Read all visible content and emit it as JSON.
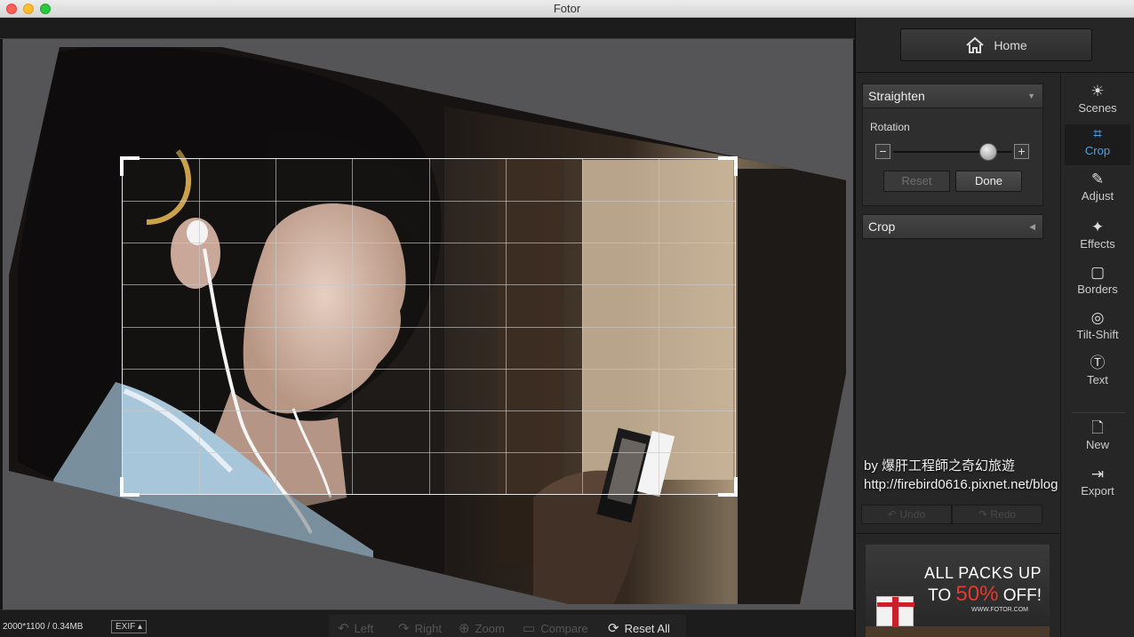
{
  "window": {
    "title": "Fotor"
  },
  "home": {
    "label": "Home",
    "icon": "house-icon"
  },
  "straighten": {
    "title": "Straighten",
    "rotation_label": "Rotation",
    "minus": "−",
    "plus": "+",
    "slider_value": 0.8,
    "reset_label": "Reset",
    "done_label": "Done"
  },
  "crop_section": {
    "title": "Crop"
  },
  "watermark": {
    "line1": "by 爆肝工程師之奇幻旅遊",
    "line2": "http://firebird0616.pixnet.net/blog"
  },
  "history": {
    "undo_label": "Undo",
    "redo_label": "Redo"
  },
  "sidebar": {
    "items": [
      {
        "label": "Scenes",
        "icon": "sun-icon"
      },
      {
        "label": "Crop",
        "icon": "crop-icon",
        "active": true
      },
      {
        "label": "Adjust",
        "icon": "pencil-icon"
      },
      {
        "label": "Effects",
        "icon": "sparkle-icon"
      },
      {
        "label": "Borders",
        "icon": "border-icon"
      },
      {
        "label": "Tilt-Shift",
        "icon": "target-icon"
      },
      {
        "label": "Text",
        "icon": "text-icon"
      },
      {
        "label": "New",
        "icon": "new-document-icon"
      },
      {
        "label": "Export",
        "icon": "export-icon"
      }
    ]
  },
  "ad": {
    "line1": "ALL PACKS UP",
    "line2_prefix": "TO ",
    "line2_percent": "50%",
    "line2_suffix": " OFF!",
    "url": "WWW.FOTOR.COM"
  },
  "status": {
    "image_info": "2000*1100 / 0.34MB",
    "exif_label": "EXIF ▴"
  },
  "bottom_tools": {
    "left": "Left",
    "right": "Right",
    "zoom": "Zoom",
    "compare": "Compare",
    "reset_all": "Reset All"
  },
  "crop_grid": {
    "columns": 8,
    "rows": 8
  },
  "colors": {
    "accent": "#4aa3f0",
    "panel": "#262626",
    "canvas": "#555558",
    "ad_red": "#e23b2e"
  }
}
